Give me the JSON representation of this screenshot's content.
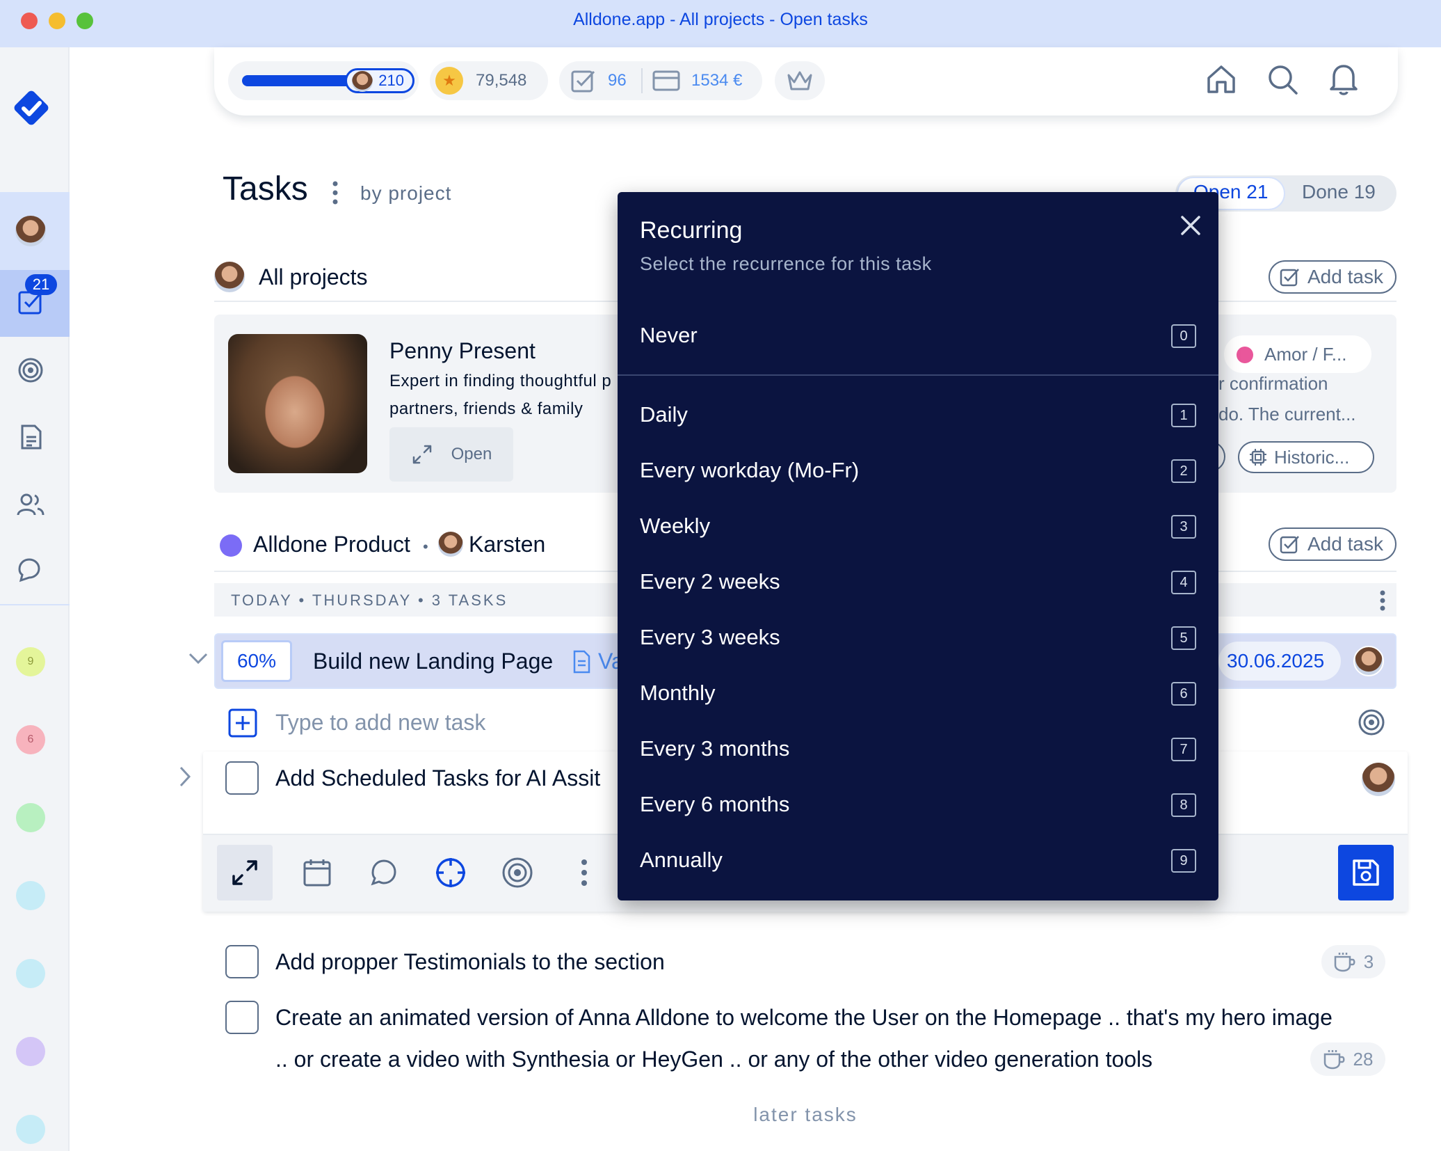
{
  "window": {
    "title": "Alldone.app - All projects - Open tasks"
  },
  "topbar": {
    "xp_value": "210",
    "gold_value": "79,548",
    "done_count": "96",
    "money": "1534 €"
  },
  "sidebar": {
    "tasks_badge": "21",
    "project_counts": [
      "9",
      "6"
    ],
    "colors": {
      "selected_bg": "#d6e2fb",
      "accent": "#0d47e0"
    }
  },
  "header": {
    "title": "Tasks",
    "subtitle": "by project",
    "tab_open": "Open 21",
    "tab_done": "Done 19"
  },
  "all_projects": {
    "title": "All projects",
    "add_task": "Add task",
    "assistant": {
      "name": "Penny Present",
      "desc_line1": "Expert in finding thoughtful p",
      "desc_line2": "partners, friends & family",
      "open_label": "Open"
    },
    "right_card": {
      "tag": "Amor / F...",
      "line1": "r confirmation",
      "line2": "do. The current...",
      "historic": "Historic..."
    }
  },
  "project": {
    "name": "Alldone Product",
    "separator": "•",
    "owner": "Karsten",
    "add_task": "Add task",
    "color": "#7b6cf6",
    "today_label": "TODAY • THURSDAY • 3 TASKS",
    "active_task": {
      "progress": "60%",
      "title": "Build new Landing Page",
      "link_label": "Va",
      "due": "30.06.2025"
    },
    "new_task_placeholder": "Type to add new task",
    "editing_task": "Add Scheduled Tasks for AI Assit",
    "tasks": [
      {
        "title": "Add propper Testimonials to the section",
        "estimate": "3"
      },
      {
        "title_line1": "Create an animated version of Anna Alldone to welcome the User on the Homepage .. that's my hero image",
        "title_line2": ".. or create a video with Synthesia or HeyGen .. or any of the other video generation tools",
        "estimate": "28"
      }
    ],
    "later": "later tasks"
  },
  "modal": {
    "title": "Recurring",
    "subtitle": "Select the recurrence for this task",
    "options": [
      {
        "label": "Never",
        "key": "0"
      },
      {
        "label": "Daily",
        "key": "1"
      },
      {
        "label": "Every workday (Mo-Fr)",
        "key": "2"
      },
      {
        "label": "Weekly",
        "key": "3"
      },
      {
        "label": "Every 2 weeks",
        "key": "4"
      },
      {
        "label": "Every 3 weeks",
        "key": "5"
      },
      {
        "label": "Monthly",
        "key": "6"
      },
      {
        "label": "Every 3 months",
        "key": "7"
      },
      {
        "label": "Every 6 months",
        "key": "8"
      },
      {
        "label": "Annually",
        "key": "9"
      }
    ],
    "bg_color": "#0b1440"
  }
}
